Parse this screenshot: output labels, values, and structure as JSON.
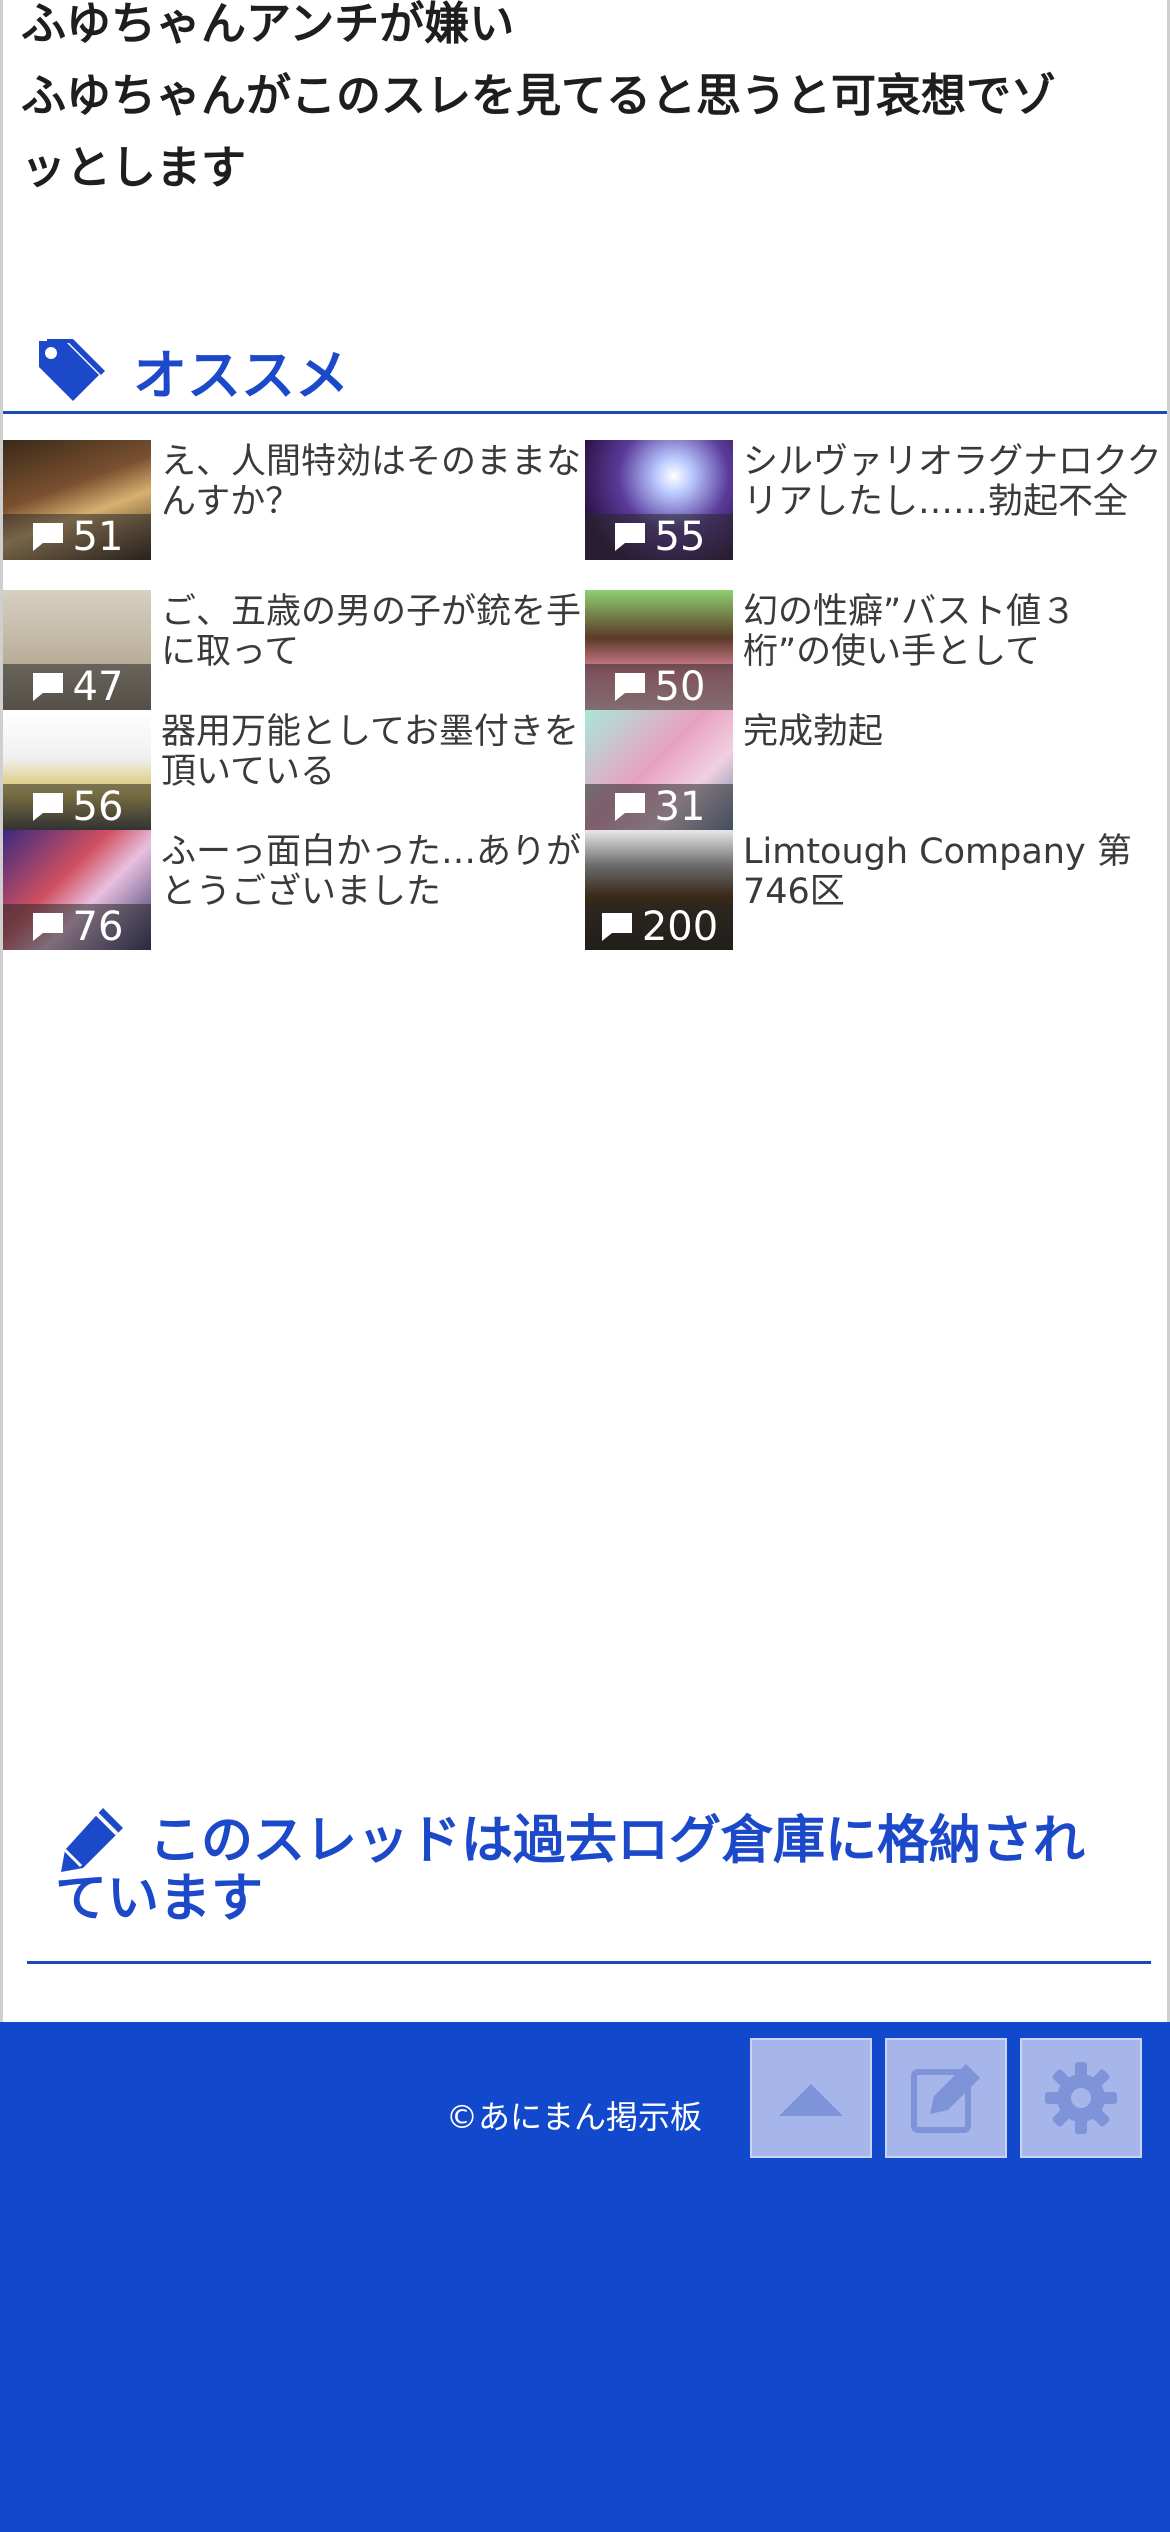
{
  "post": {
    "lines": [
      "ふゆちゃんアンチが嫌い",
      "ふゆちゃんがこのスレを見てると思うと可哀想でゾ",
      "ッとします"
    ]
  },
  "recommend": {
    "title": "オススメ",
    "items": [
      {
        "title": "え、人間特効はそのままなんすか？",
        "count": "51"
      },
      {
        "title": "シルヴァリオラグナロククリアしたし……勃起不全",
        "count": "55"
      },
      {
        "title": "ご、五歳の男の子が銃を手に取って",
        "count": "47"
      },
      {
        "title": "幻の性癖”バスト値３桁”の使い手として",
        "count": "50"
      },
      {
        "title": "器用万能としてお墨付きを頂いている",
        "count": "56"
      },
      {
        "title": "完成勃起",
        "count": "31"
      },
      {
        "title": "ふーっ面白かった…ありがとうございました",
        "count": "76"
      },
      {
        "title": "Limtough Company 第746区",
        "count": "200"
      }
    ]
  },
  "archive": {
    "message": "このスレッドは過去ログ倉庫に格納されています"
  },
  "footer": {
    "copyright": "©あにまん掲示板"
  },
  "colors": {
    "accent": "#1c49c9",
    "footer_bg": "#1249cc",
    "footer_button": "#a6b6ea"
  }
}
